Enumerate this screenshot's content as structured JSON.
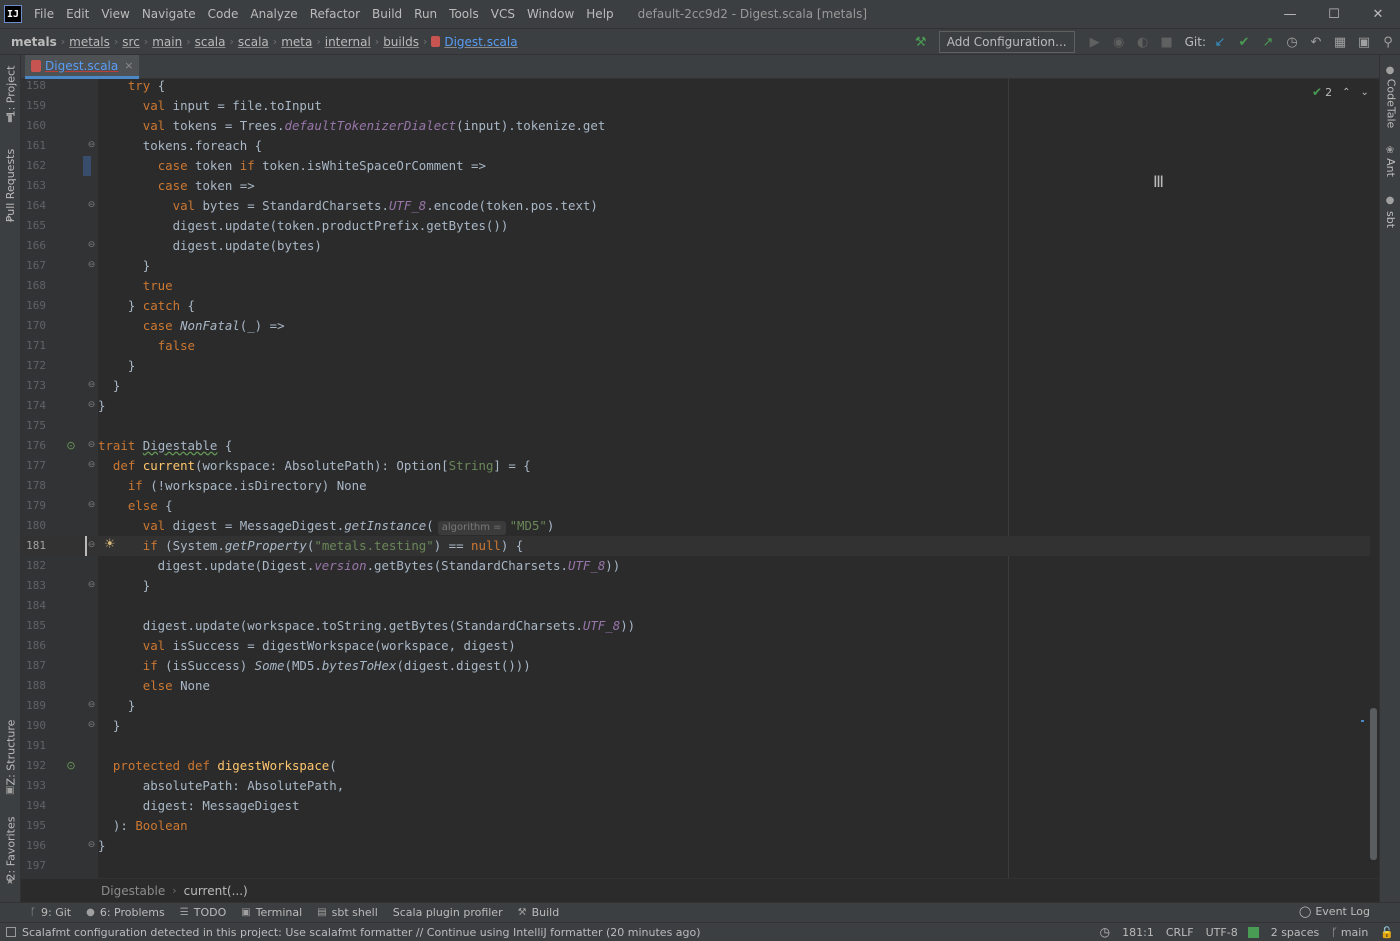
{
  "app": {
    "logo_text": "IJ",
    "window_title": "default-2cc9d2 - Digest.scala [metals]",
    "menu": [
      "File",
      "Edit",
      "View",
      "Navigate",
      "Code",
      "Analyze",
      "Refactor",
      "Build",
      "Run",
      "Tools",
      "VCS",
      "Window",
      "Help"
    ]
  },
  "navbar": {
    "breadcrumbs": [
      "metals",
      "metals",
      "src",
      "main",
      "scala",
      "scala",
      "meta",
      "internal",
      "builds",
      "Digest.scala"
    ],
    "add_config_label": "Add Configuration...",
    "git_label": "Git:"
  },
  "left_tools": [
    "1: Project",
    "Pull Requests",
    "Z: Structure",
    "2: Favorites"
  ],
  "right_tools": [
    "CodeTale",
    "Ant",
    "sbt"
  ],
  "editor": {
    "tab_label": "Digest.scala",
    "tab_close": "×",
    "inspection_count": "2",
    "current_line": 181
  },
  "code_crumbs": [
    "Digestable",
    "current(...)"
  ],
  "tool_windows": [
    {
      "label": "9: Git",
      "icon": "git-branch-icon",
      "glyph": "ᚴ"
    },
    {
      "label": "6: Problems",
      "icon": "problems-icon",
      "glyph": "●"
    },
    {
      "label": "TODO",
      "icon": "todo-icon",
      "glyph": "☰"
    },
    {
      "label": "Terminal",
      "icon": "terminal-icon",
      "glyph": "▣"
    },
    {
      "label": "sbt shell",
      "icon": "sbt-shell-icon",
      "glyph": "▤"
    },
    {
      "label": "Scala plugin profiler",
      "icon": "",
      "glyph": ""
    },
    {
      "label": "Build",
      "icon": "build-hammer-icon",
      "glyph": "⚒"
    }
  ],
  "event_log_label": "Event Log",
  "status": {
    "message": "Scalafmt configuration detected in this project: Use scalafmt formatter // Continue using IntelliJ formatter (20 minutes ago)",
    "position": "181:1",
    "line_sep": "CRLF",
    "encoding": "UTF-8",
    "indent": "2 spaces",
    "branch": "main"
  },
  "code_lines": [
    {
      "n": "158",
      "html": "    <span class='kw'>try</span> {"
    },
    {
      "n": "159",
      "html": "      <span class='kw'>val</span> input = file.toInput"
    },
    {
      "n": "160",
      "html": "      <span class='kw'>val</span> tokens = Trees.<span class='it'>defaultTokenizerDialect</span>(input).tokenize.get"
    },
    {
      "n": "161",
      "html": "      tokens.foreach {"
    },
    {
      "n": "162",
      "html": "        <span class='kw'>case</span> token <span class='kw'>if</span> token.isWhiteSpaceOrComment =>"
    },
    {
      "n": "163",
      "html": "        <span class='kw'>case</span> token =>"
    },
    {
      "n": "164",
      "html": "          <span class='kw'>val</span> bytes = StandardCharsets.<span class='it'>UTF_8</span>.encode(token.pos.text)"
    },
    {
      "n": "165",
      "html": "          digest.update(token.productPrefix.getBytes())"
    },
    {
      "n": "166",
      "html": "          digest.update(bytes)"
    },
    {
      "n": "167",
      "html": "      }"
    },
    {
      "n": "168",
      "html": "      <span class='kw'>true</span>"
    },
    {
      "n": "169",
      "html": "    } <span class='kw'>catch</span> {"
    },
    {
      "n": "170",
      "html": "      <span class='kw'>case</span> <span class='ital'>NonFatal</span>(_) =>"
    },
    {
      "n": "171",
      "html": "        <span class='kw'>false</span>"
    },
    {
      "n": "172",
      "html": "    }"
    },
    {
      "n": "173",
      "html": "  }"
    },
    {
      "n": "174",
      "html": "}"
    },
    {
      "n": "175",
      "html": ""
    },
    {
      "n": "176",
      "html": "<span class='kw'>trait</span> <span class='under-green'>Digestable</span> {"
    },
    {
      "n": "177",
      "html": "  <span class='kw'>def</span> <span class='fn'>current</span>(workspace: AbsolutePath): Option[<span class='str'>String</span>] = {"
    },
    {
      "n": "178",
      "html": "    <span class='kw'>if</span> (!workspace.isDirectory) None"
    },
    {
      "n": "179",
      "html": "    <span class='kw'>else</span> {"
    },
    {
      "n": "180",
      "html": "      <span class='kw'>val</span> digest = MessageDigest.<span class='ital'>getInstance</span>(<span class='hint'>algorithm =</span><span class='str'>\"MD5\"</span>)"
    },
    {
      "n": "181",
      "html": "      <span class='kw'>if</span> (System.<span class='ital'>getProperty</span>(<span class='str'>\"metals.testing\"</span>) == <span class='kw'>null</span>) {"
    },
    {
      "n": "182",
      "html": "        digest.update(Digest.<span class='it'>version</span>.getBytes(StandardCharsets.<span class='it'>UTF_8</span>))"
    },
    {
      "n": "183",
      "html": "      }"
    },
    {
      "n": "184",
      "html": ""
    },
    {
      "n": "185",
      "html": "      digest.update(workspace.toString.getBytes(StandardCharsets.<span class='it'>UTF_8</span>))"
    },
    {
      "n": "186",
      "html": "      <span class='kw'>val</span> isSuccess = digestWorkspace(workspace, digest)"
    },
    {
      "n": "187",
      "html": "      <span class='kw'>if</span> (isSuccess) <span class='ital'>Some</span>(MD5.<span class='ital'>bytesToHex</span>(digest.digest()))"
    },
    {
      "n": "188",
      "html": "      <span class='kw'>else</span> None"
    },
    {
      "n": "189",
      "html": "    }"
    },
    {
      "n": "190",
      "html": "  }"
    },
    {
      "n": "191",
      "html": ""
    },
    {
      "n": "192",
      "html": "  <span class='kw'>protected def</span> <span class='fn'>digestWorkspace</span>("
    },
    {
      "n": "193",
      "html": "      absolutePath: AbsolutePath,"
    },
    {
      "n": "194",
      "html": "      digest: MessageDigest"
    },
    {
      "n": "195",
      "html": "  ): <span class='kw'>Boolean</span>"
    },
    {
      "n": "196",
      "html": "}"
    },
    {
      "n": "197",
      "html": ""
    }
  ]
}
